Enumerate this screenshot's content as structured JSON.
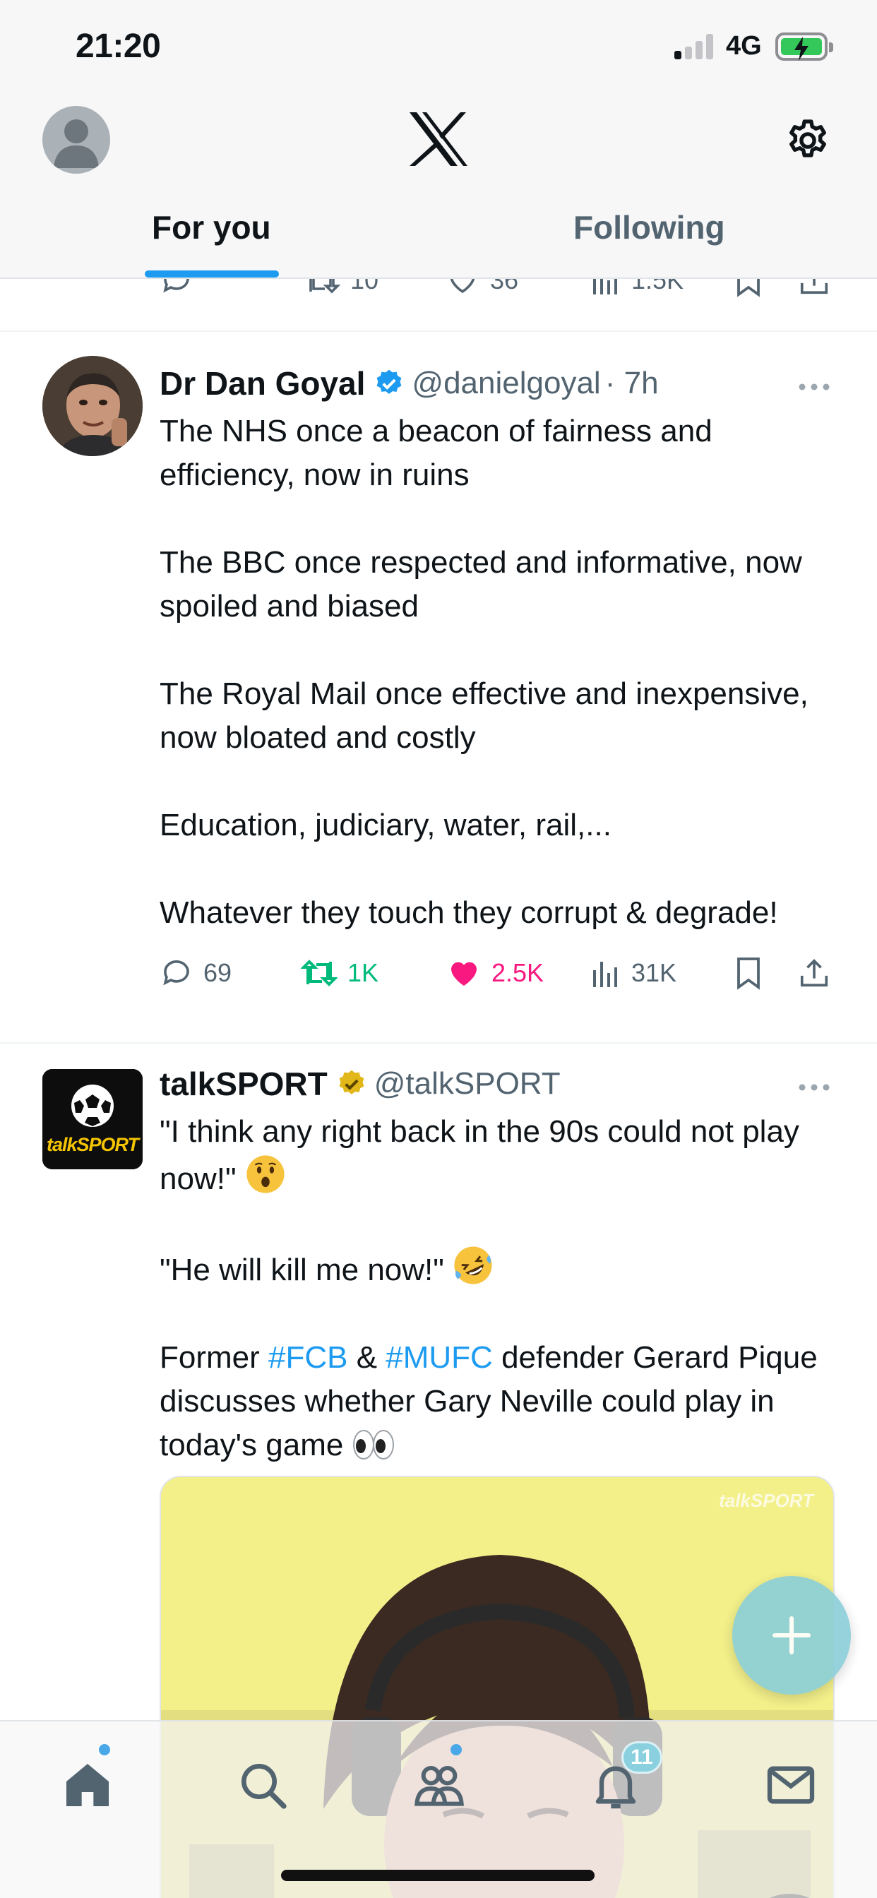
{
  "status_bar": {
    "time": "21:20",
    "network": "4G"
  },
  "header": {
    "logo": "x-logo-icon",
    "tabs": [
      {
        "label": "For you",
        "active": true
      },
      {
        "label": "Following",
        "active": false
      }
    ]
  },
  "previous_tweet_actions": {
    "retweets": "10",
    "likes": "36",
    "views": "1.5K"
  },
  "tweets": [
    {
      "name": "Dr Dan Goyal",
      "verified": "blue",
      "handle": "@danielgoyal",
      "time": "· 7h",
      "paragraphs": [
        "The NHS once a beacon of fairness and efficiency, now in ruins",
        "The BBC once respected and informative, now spoiled and biased",
        "The Royal Mail once effective and inexpensive, now bloated and costly",
        "Education, judiciary, water, rail,...",
        "Whatever they touch they corrupt & degrade!"
      ],
      "replies": "69",
      "retweets": "1K",
      "likes": "2.5K",
      "views": "31K",
      "liked": true,
      "retweeted": true
    },
    {
      "name": "talkSPORT",
      "verified": "gold",
      "handle": "@talkSPORT",
      "avatar_text": "talkSPORT",
      "line1": "\"I think any right back in the 90s could not play now!\"",
      "line2": "\"He will kill me now!\"",
      "line3_pre": "Former ",
      "hashtag1": "#FCB",
      "line3_mid": " & ",
      "hashtag2": "#MUFC",
      "line3_post": " defender Gerard Pique discusses whether Gary Neville could play in today's game",
      "media_watermark": "talkSPORT"
    }
  ],
  "bottom_nav": {
    "items": [
      "home-icon",
      "search-icon",
      "communities-icon",
      "notifications-icon",
      "messages-icon"
    ],
    "notifications_count": "11"
  },
  "colors": {
    "accent": "#1d9bf0",
    "like": "#f91880",
    "retweet": "#00ba7c",
    "gold_badge": "#e2b719"
  }
}
